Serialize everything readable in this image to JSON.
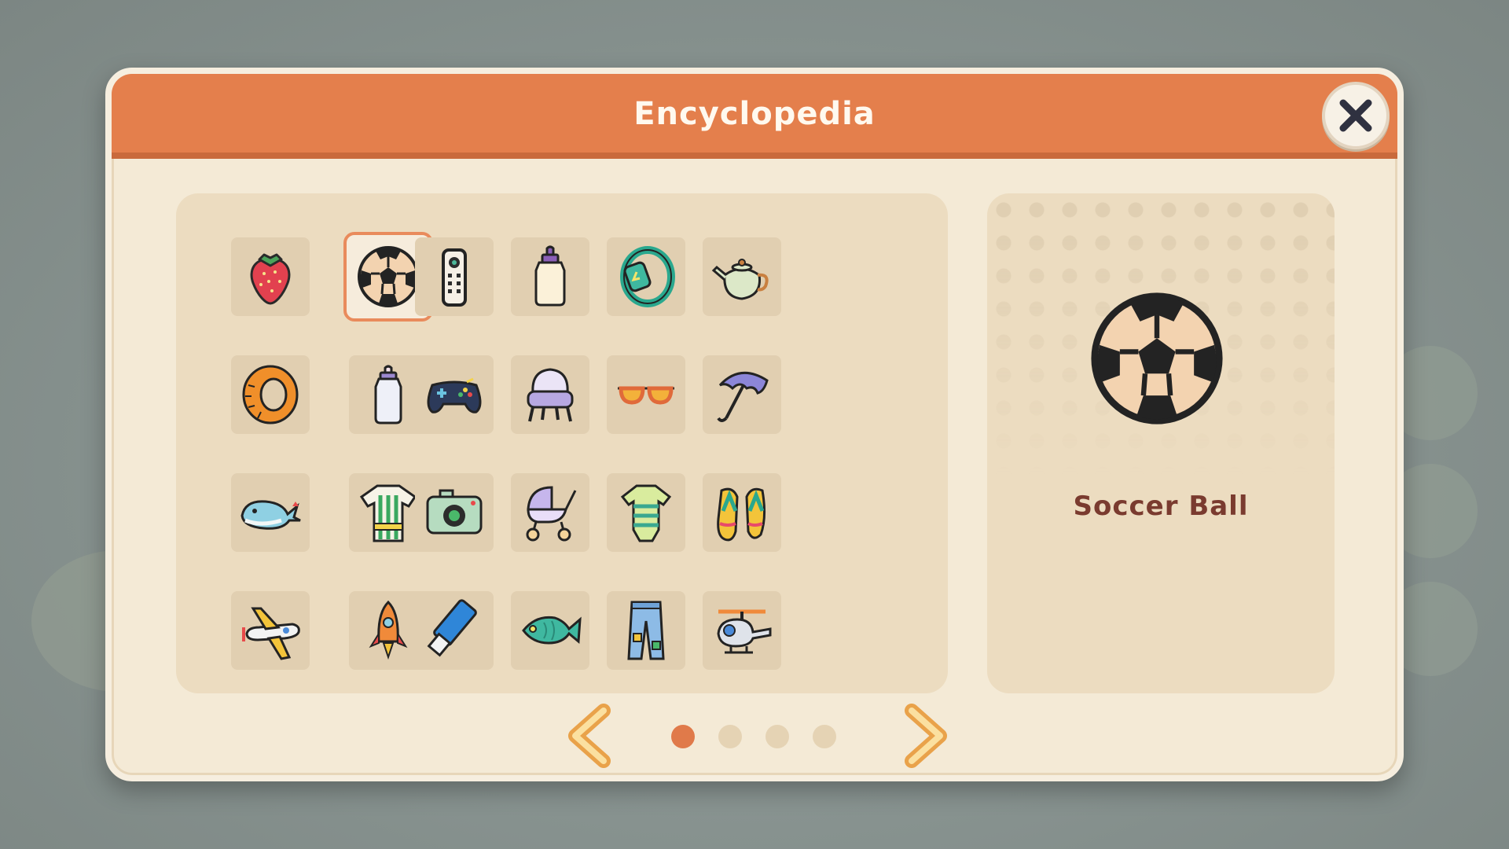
{
  "dialog": {
    "title": "Encyclopedia",
    "close_icon": "close-icon"
  },
  "grid": {
    "columns": 6,
    "items": [
      {
        "name": "strawberry",
        "icon": "strawberry-icon"
      },
      {
        "name": "soccer-ball",
        "icon": "soccer-ball-icon",
        "selected": true
      },
      {
        "name": "remote-control",
        "icon": "remote-control-icon"
      },
      {
        "name": "baby-bottle",
        "icon": "baby-bottle-icon"
      },
      {
        "name": "smartwatch",
        "icon": "smartwatch-icon"
      },
      {
        "name": "teapot",
        "icon": "teapot-icon"
      },
      {
        "name": "tire",
        "icon": "tire-icon"
      },
      {
        "name": "milk-bottle",
        "icon": "milk-bottle-icon"
      },
      {
        "name": "game-controller",
        "icon": "game-controller-icon"
      },
      {
        "name": "armchair",
        "icon": "armchair-icon"
      },
      {
        "name": "sunglasses",
        "icon": "sunglasses-icon"
      },
      {
        "name": "umbrella",
        "icon": "umbrella-icon"
      },
      {
        "name": "whale",
        "icon": "whale-icon"
      },
      {
        "name": "jersey",
        "icon": "jersey-icon"
      },
      {
        "name": "camera",
        "icon": "camera-icon"
      },
      {
        "name": "stroller",
        "icon": "stroller-icon"
      },
      {
        "name": "onesie",
        "icon": "onesie-icon"
      },
      {
        "name": "flip-flops",
        "icon": "flip-flops-icon"
      },
      {
        "name": "airplane",
        "icon": "airplane-icon"
      },
      {
        "name": "rocket",
        "icon": "rocket-icon"
      },
      {
        "name": "usb-drive",
        "icon": "usb-drive-icon"
      },
      {
        "name": "fish",
        "icon": "fish-icon"
      },
      {
        "name": "jeans",
        "icon": "jeans-icon"
      },
      {
        "name": "helicopter",
        "icon": "helicopter-icon"
      }
    ]
  },
  "detail": {
    "name": "Soccer Ball",
    "icon": "soccer-ball-icon"
  },
  "pagination": {
    "current_page": 1,
    "total_pages": 4,
    "prev_icon": "chevron-left-icon",
    "next_icon": "chevron-right-icon"
  },
  "colors": {
    "header": "#e47f4c",
    "panel": "#ecdcc0",
    "dialog": "#f4ead6",
    "accent": "#e07a4a",
    "detail_text": "#7a3b2f"
  }
}
